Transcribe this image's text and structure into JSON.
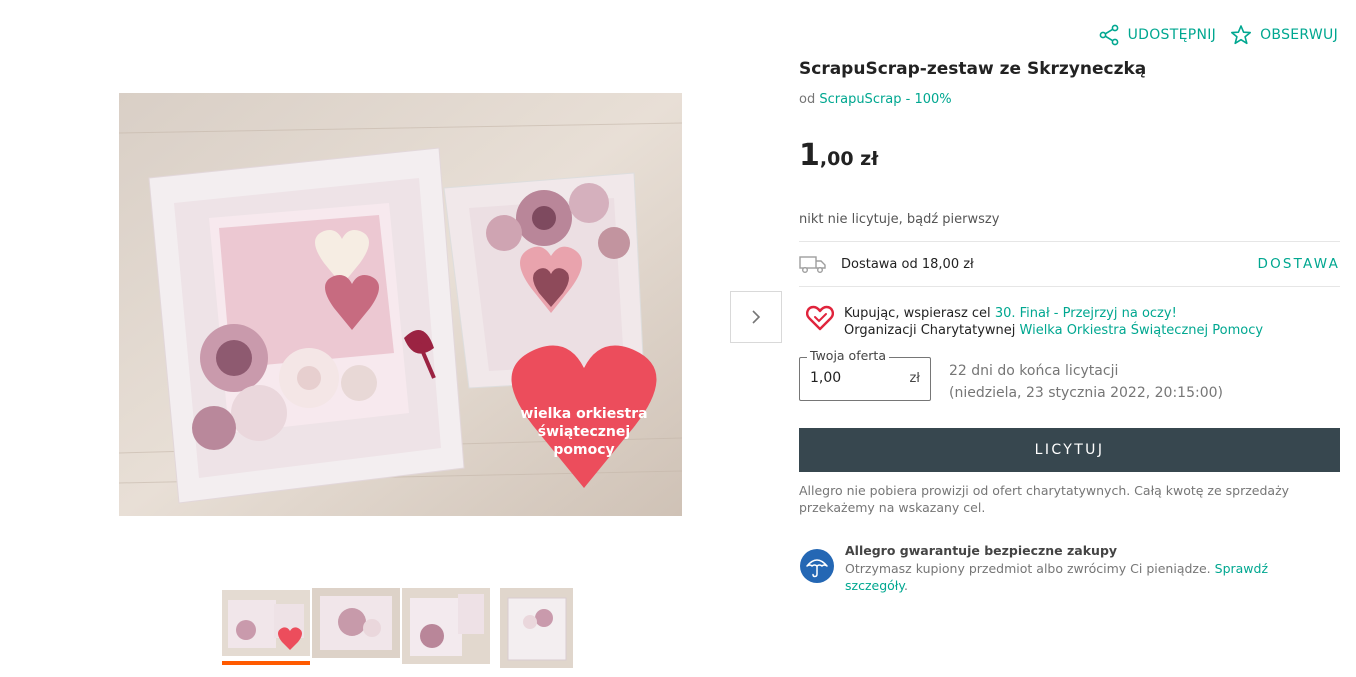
{
  "actions": {
    "share_label": "UDOSTĘPNIJ",
    "watch_label": "OBSERWUJ"
  },
  "product": {
    "title": "ScrapuScrap-zestaw ze Skrzyneczką",
    "seller_prefix": "od",
    "seller_link": "ScrapuScrap - 100%",
    "price_main": "1",
    "price_rest": ",00 zł",
    "bid_status": "nikt nie licytuje, bądź pierwszy"
  },
  "delivery": {
    "text": "Dostawa od 18,00 zł",
    "link": "DOSTAWA"
  },
  "charity": {
    "line1_prefix": "Kupując, wspierasz cel",
    "line1_link": "30. Finał - Przejrzyj na oczy!",
    "line2_prefix": "Organizacji Charytatywnej",
    "line2_link": "Wielka Orkiestra Świątecznej Pomocy"
  },
  "offer": {
    "label": "Twoja oferta",
    "value": "1,00",
    "currency": "zł"
  },
  "ending": {
    "line1": "22 dni do końca licytacji",
    "line2": "(niedziela, 23 stycznia 2022, 20:15:00)"
  },
  "bid_button": "LICYTUJ",
  "note": "Allegro nie pobiera prowizji od ofert charytatywnych. Całą kwotę ze sprzedaży przekażemy na wskazany cel.",
  "guarantee": {
    "title": "Allegro gwarantuje bezpieczne zakupy",
    "text": "Otrzymasz kupiony przedmiot albo zwrócimy Ci pieniądze.",
    "link": "Sprawdź szczegóły",
    "suffix": "."
  },
  "image_badge": {
    "line1": "wielka orkiestra",
    "line2": "świątecznej",
    "line3": "pomocy"
  },
  "colors": {
    "accent": "#00a790",
    "button": "#37474f",
    "active_thumb": "#ff5a00",
    "charity_heart": "#e0243c",
    "shield": "#2467b4"
  }
}
